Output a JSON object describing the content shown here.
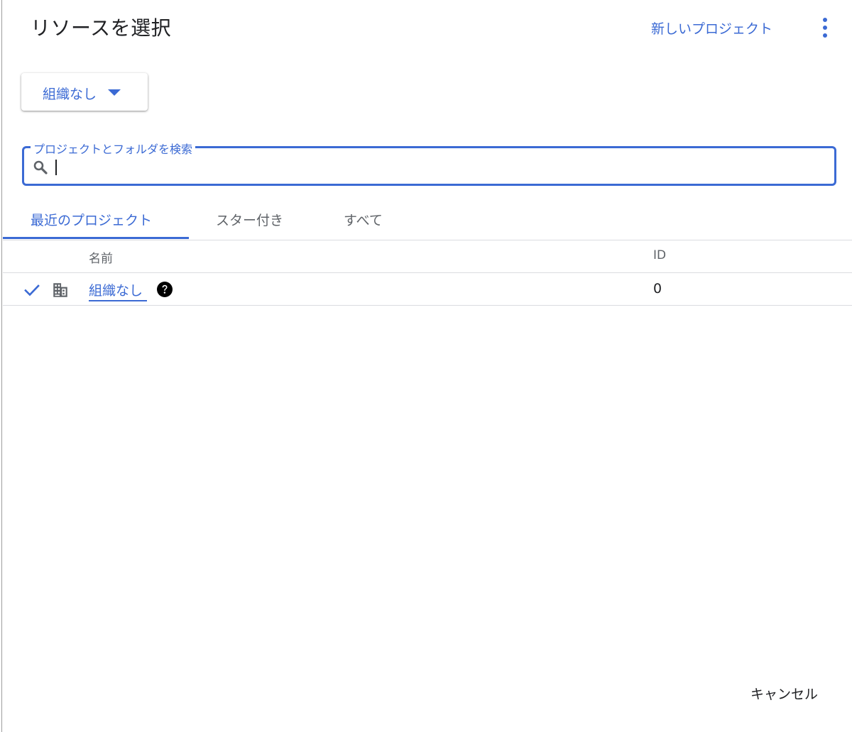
{
  "dialog": {
    "title": "リソースを選択",
    "new_project_label": "新しいプロジェクト",
    "more_menu_icon": "more-vert-icon",
    "cancel_label": "キャンセル"
  },
  "org_selector": {
    "selected": "組織なし",
    "icon": "arrow-drop-down-icon"
  },
  "search": {
    "label": "プロジェクトとフォルダを検索",
    "value": "",
    "icon": "search-icon"
  },
  "tabs": [
    {
      "label": "最近のプロジェクト",
      "active": true
    },
    {
      "label": "スター付き",
      "active": false
    },
    {
      "label": "すべて",
      "active": false
    }
  ],
  "table": {
    "columns": [
      "名前",
      "ID"
    ],
    "rows": [
      {
        "selected": true,
        "type_icon": "domain-building-icon",
        "name": "組織なし",
        "help_icon": "help-icon",
        "id": "0"
      }
    ]
  },
  "colors": {
    "accent": "#3b6ad4",
    "text_primary": "#202124",
    "text_secondary": "#5f6368",
    "divider": "#dadce0"
  }
}
